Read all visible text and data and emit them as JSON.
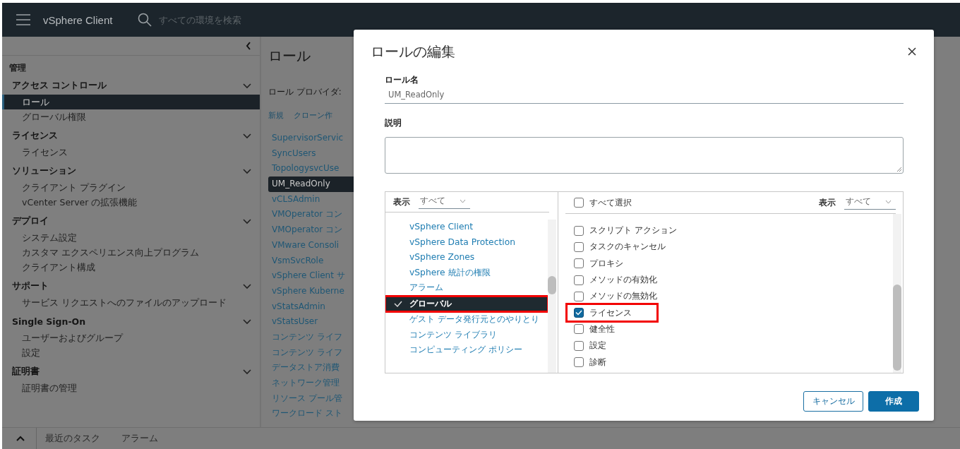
{
  "header": {
    "app_title": "vSphere Client",
    "search_placeholder": "すべての環境を検索"
  },
  "sidebar": {
    "heading": "管理",
    "sections": [
      {
        "title": "アクセス コントロール",
        "expanded": true,
        "items": [
          {
            "label": "ロール",
            "selected": true
          },
          {
            "label": "グローバル権限",
            "selected": false
          }
        ]
      },
      {
        "title": "ライセンス",
        "expanded": true,
        "items": [
          {
            "label": "ライセンス",
            "selected": false
          }
        ]
      },
      {
        "title": "ソリューション",
        "expanded": true,
        "items": [
          {
            "label": "クライアント プラグイン",
            "selected": false
          },
          {
            "label": "vCenter Server の拡張機能",
            "selected": false
          }
        ]
      },
      {
        "title": "デプロイ",
        "expanded": true,
        "items": [
          {
            "label": "システム設定",
            "selected": false
          },
          {
            "label": "カスタマ エクスペリエンス向上プログラム",
            "selected": false
          },
          {
            "label": "クライアント構成",
            "selected": false
          }
        ]
      },
      {
        "title": "サポート",
        "expanded": true,
        "items": [
          {
            "label": "サービス リクエストへのファイルのアップロード",
            "selected": false
          }
        ]
      },
      {
        "title": "Single Sign-On",
        "expanded": true,
        "items": [
          {
            "label": "ユーザーおよびグループ",
            "selected": false
          },
          {
            "label": "設定",
            "selected": false
          }
        ]
      },
      {
        "title": "証明書",
        "expanded": true,
        "items": [
          {
            "label": "証明書の管理",
            "selected": false
          }
        ]
      }
    ]
  },
  "content": {
    "title": "ロール",
    "provider_label": "ロール プロバイダ:",
    "actions": [
      "新規",
      "クローン作"
    ],
    "roles": [
      {
        "label": "SupervisorServic",
        "selected": false
      },
      {
        "label": "SyncUsers",
        "selected": false
      },
      {
        "label": "TopologysvcUse",
        "selected": false
      },
      {
        "label": "UM_ReadOnly",
        "selected": true
      },
      {
        "label": "vCLSAdmin",
        "selected": false
      },
      {
        "label": "VMOperator コン",
        "selected": false
      },
      {
        "label": "VMOperator コン",
        "selected": false
      },
      {
        "label": "VMware Consoli",
        "selected": false
      },
      {
        "label": "VsmSvcRole",
        "selected": false
      },
      {
        "label": "vSphere Client サ",
        "selected": false
      },
      {
        "label": "vSphere Kuberne",
        "selected": false
      },
      {
        "label": "vStatsAdmin",
        "selected": false
      },
      {
        "label": "vStatsUser",
        "selected": false
      },
      {
        "label": "コンテンツ ライフ",
        "selected": false
      },
      {
        "label": "コンテンツ ライフ",
        "selected": false
      },
      {
        "label": "データストア消費",
        "selected": false
      },
      {
        "label": "ネットワーク管理",
        "selected": false
      },
      {
        "label": "リソース プール管",
        "selected": false
      },
      {
        "label": "ワークロード スト",
        "selected": false
      }
    ]
  },
  "bottom_bar": {
    "tabs": [
      "最近のタスク",
      "アラーム"
    ]
  },
  "dialog": {
    "title": "ロールの編集",
    "role_name_label": "ロール名",
    "role_name_value": "UM_ReadOnly",
    "description_label": "説明",
    "categories": {
      "filter_label": "表示",
      "filter_value": "すべて",
      "items": [
        {
          "label": "vSphere Client",
          "selected": false,
          "highlighted": false
        },
        {
          "label": "vSphere Data Protection",
          "selected": false,
          "highlighted": false
        },
        {
          "label": "vSphere Zones",
          "selected": false,
          "highlighted": false
        },
        {
          "label": "vSphere 統計の権限",
          "selected": false,
          "highlighted": false
        },
        {
          "label": "アラーム",
          "selected": false,
          "highlighted": false
        },
        {
          "label": "グローバル",
          "selected": true,
          "highlighted": true
        },
        {
          "label": "ゲスト データ発行元とのやりとり",
          "selected": false,
          "highlighted": false
        },
        {
          "label": "コンテンツ ライブラリ",
          "selected": false,
          "highlighted": false
        },
        {
          "label": "コンピューティング ポリシー",
          "selected": false,
          "highlighted": false
        }
      ]
    },
    "privileges": {
      "select_all_label": "すべて選択",
      "select_all_checked": false,
      "filter_label": "表示",
      "filter_value": "すべて",
      "items": [
        {
          "label": "スクリプト アクション",
          "checked": false,
          "highlighted": false
        },
        {
          "label": "タスクのキャンセル",
          "checked": false,
          "highlighted": false
        },
        {
          "label": "プロキシ",
          "checked": false,
          "highlighted": false
        },
        {
          "label": "メソッドの有効化",
          "checked": false,
          "highlighted": false
        },
        {
          "label": "メソッドの無効化",
          "checked": false,
          "highlighted": false
        },
        {
          "label": "ライセンス",
          "checked": true,
          "highlighted": true
        },
        {
          "label": "健全性",
          "checked": false,
          "highlighted": false
        },
        {
          "label": "設定",
          "checked": false,
          "highlighted": false
        },
        {
          "label": "診断",
          "checked": false,
          "highlighted": false
        }
      ]
    },
    "buttons": [
      {
        "label": "キャンセル",
        "kind": "secondary"
      },
      {
        "label": "作成",
        "kind": "primary"
      }
    ]
  }
}
